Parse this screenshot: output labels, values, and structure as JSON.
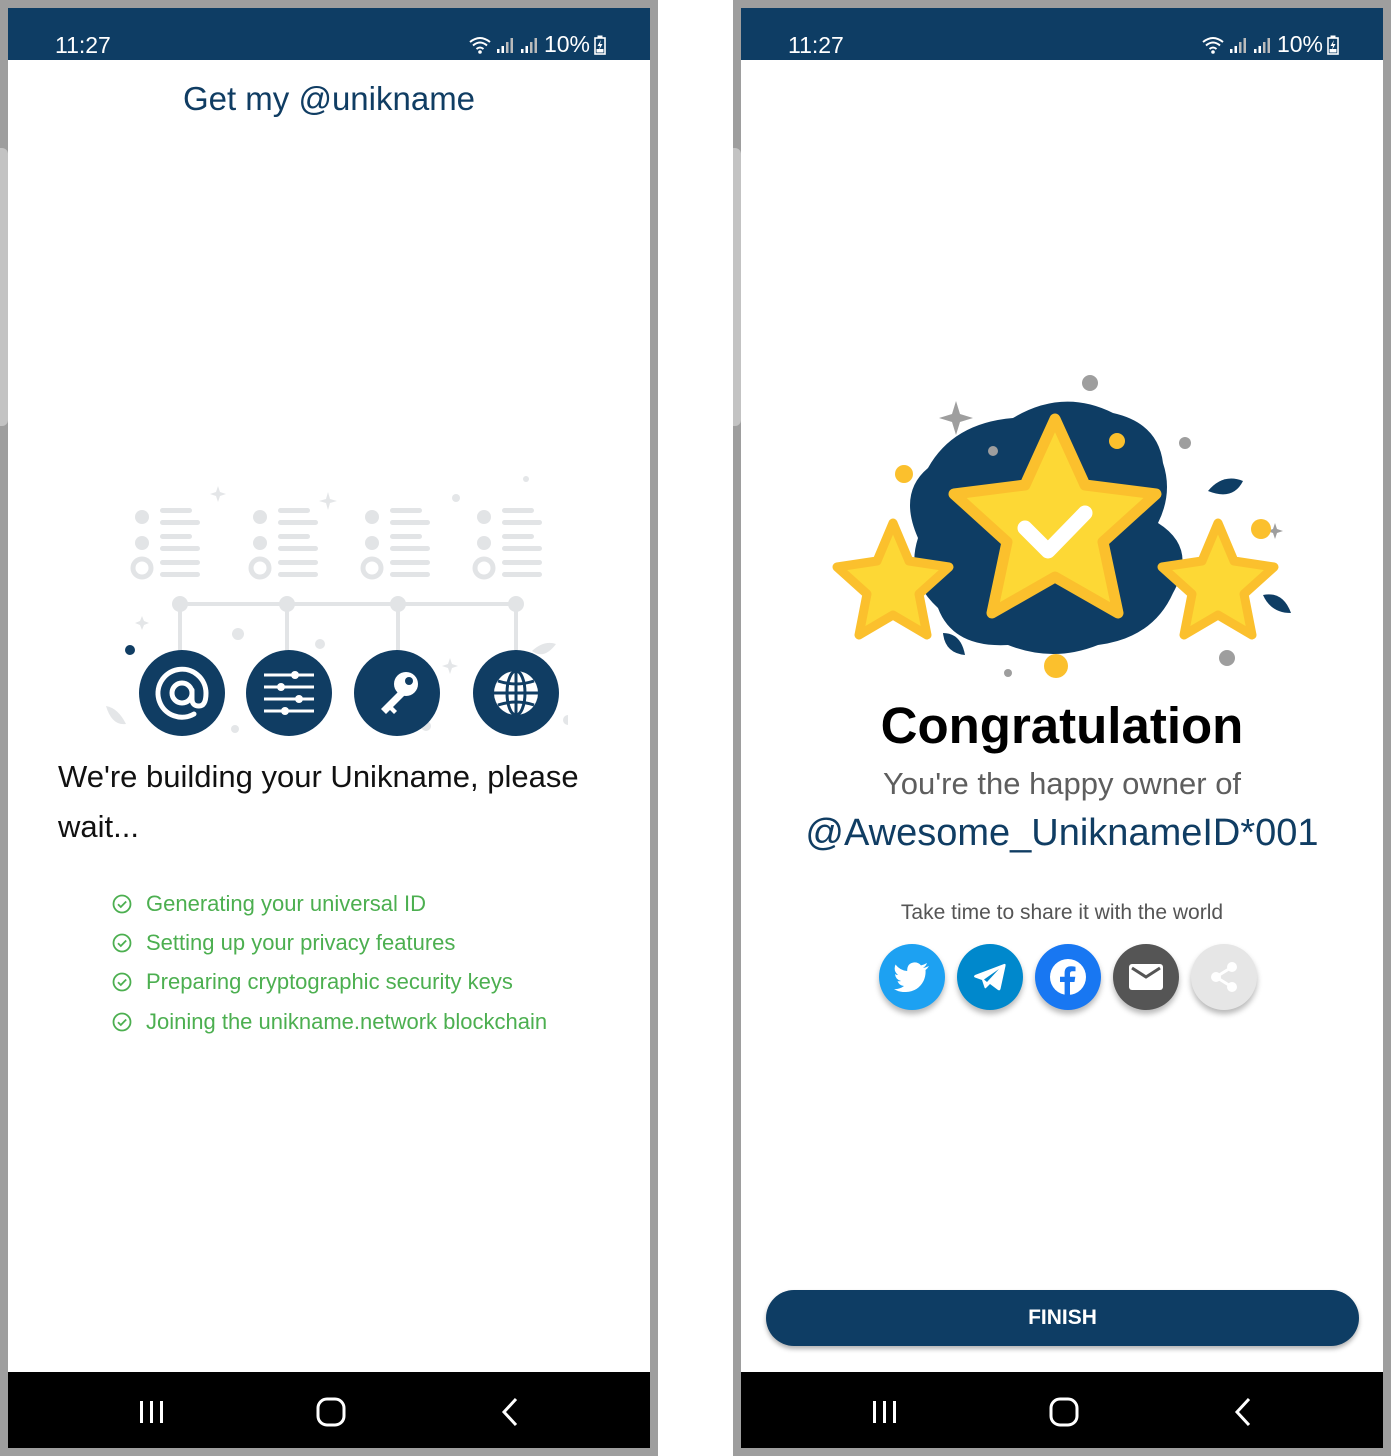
{
  "left_screen": {
    "status_bar": {
      "time": "11:27",
      "battery": "10%"
    },
    "title": "Get my @unikname",
    "message": "We're building your Unikname, please wait...",
    "steps": [
      "Generating your universal ID",
      "Setting up your privacy features",
      "Preparing cryptographic security keys",
      "Joining the unikname.network blockchain"
    ],
    "feature_icons": [
      "at-icon",
      "sliders-icon",
      "key-icon",
      "globe-icon"
    ]
  },
  "right_screen": {
    "status_bar": {
      "time": "11:27",
      "battery": "10%"
    },
    "title": "Congratulation",
    "owner_text": "You're the happy owner of",
    "uniknameid": "@Awesome_UniknameID*001",
    "share_hint": "Take time to share it with the world",
    "share_buttons": [
      {
        "icon": "twitter-icon",
        "color": "#1da1f2"
      },
      {
        "icon": "telegram-icon",
        "color": "#0088cc"
      },
      {
        "icon": "facebook-icon",
        "color": "#1877f2"
      },
      {
        "icon": "email-icon",
        "color": "#555555"
      },
      {
        "icon": "share-icon",
        "color": "#e6e6e6"
      }
    ],
    "finish_label": "FINISH"
  },
  "colors": {
    "brand_navy": "#0e3d64",
    "success_green": "#4caf50",
    "star_yellow": "#fdd835"
  }
}
